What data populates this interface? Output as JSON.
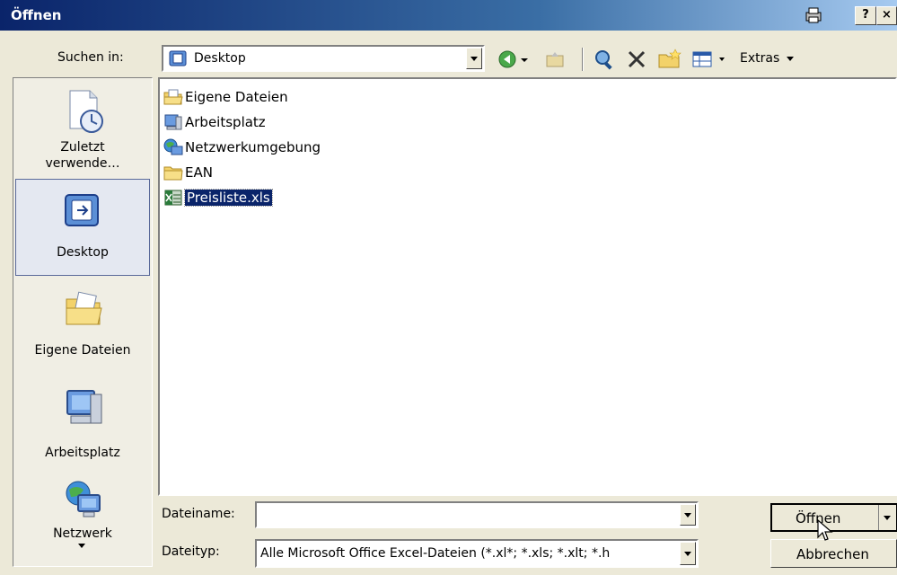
{
  "window": {
    "title": "Öffnen",
    "help_label": "?",
    "close_label": "×"
  },
  "toolbar": {
    "look_in_label": "Suchen in:",
    "look_in_value": "Desktop",
    "tools_label": "Extras"
  },
  "sidebar": {
    "items": [
      {
        "label_line1": "Zuletzt",
        "label_line2": "verwende…",
        "icon": "recent-documents-icon"
      },
      {
        "label": "Desktop",
        "icon": "desktop-icon"
      },
      {
        "label": "Eigene Dateien",
        "icon": "my-documents-icon"
      },
      {
        "label": "Arbeitsplatz",
        "icon": "my-computer-icon"
      },
      {
        "label": "Netzwerk",
        "icon": "network-icon"
      }
    ]
  },
  "files": [
    {
      "name": "Eigene Dateien",
      "icon": "my-documents-icon"
    },
    {
      "name": "Arbeitsplatz",
      "icon": "my-computer-icon"
    },
    {
      "name": "Netzwerkumgebung",
      "icon": "network-places-icon"
    },
    {
      "name": "EAN",
      "icon": "folder-icon"
    },
    {
      "name": "Preisliste.xls",
      "icon": "excel-file-icon",
      "selected": true
    }
  ],
  "form": {
    "filename_label": "Dateiname:",
    "filename_value": "",
    "filetype_label": "Dateityp:",
    "filetype_value": "Alle Microsoft Office Excel-Dateien (*.xl*; *.xls; *.xlt; *.h"
  },
  "buttons": {
    "open_label": "Öffnen",
    "cancel_label": "Abbrechen"
  }
}
